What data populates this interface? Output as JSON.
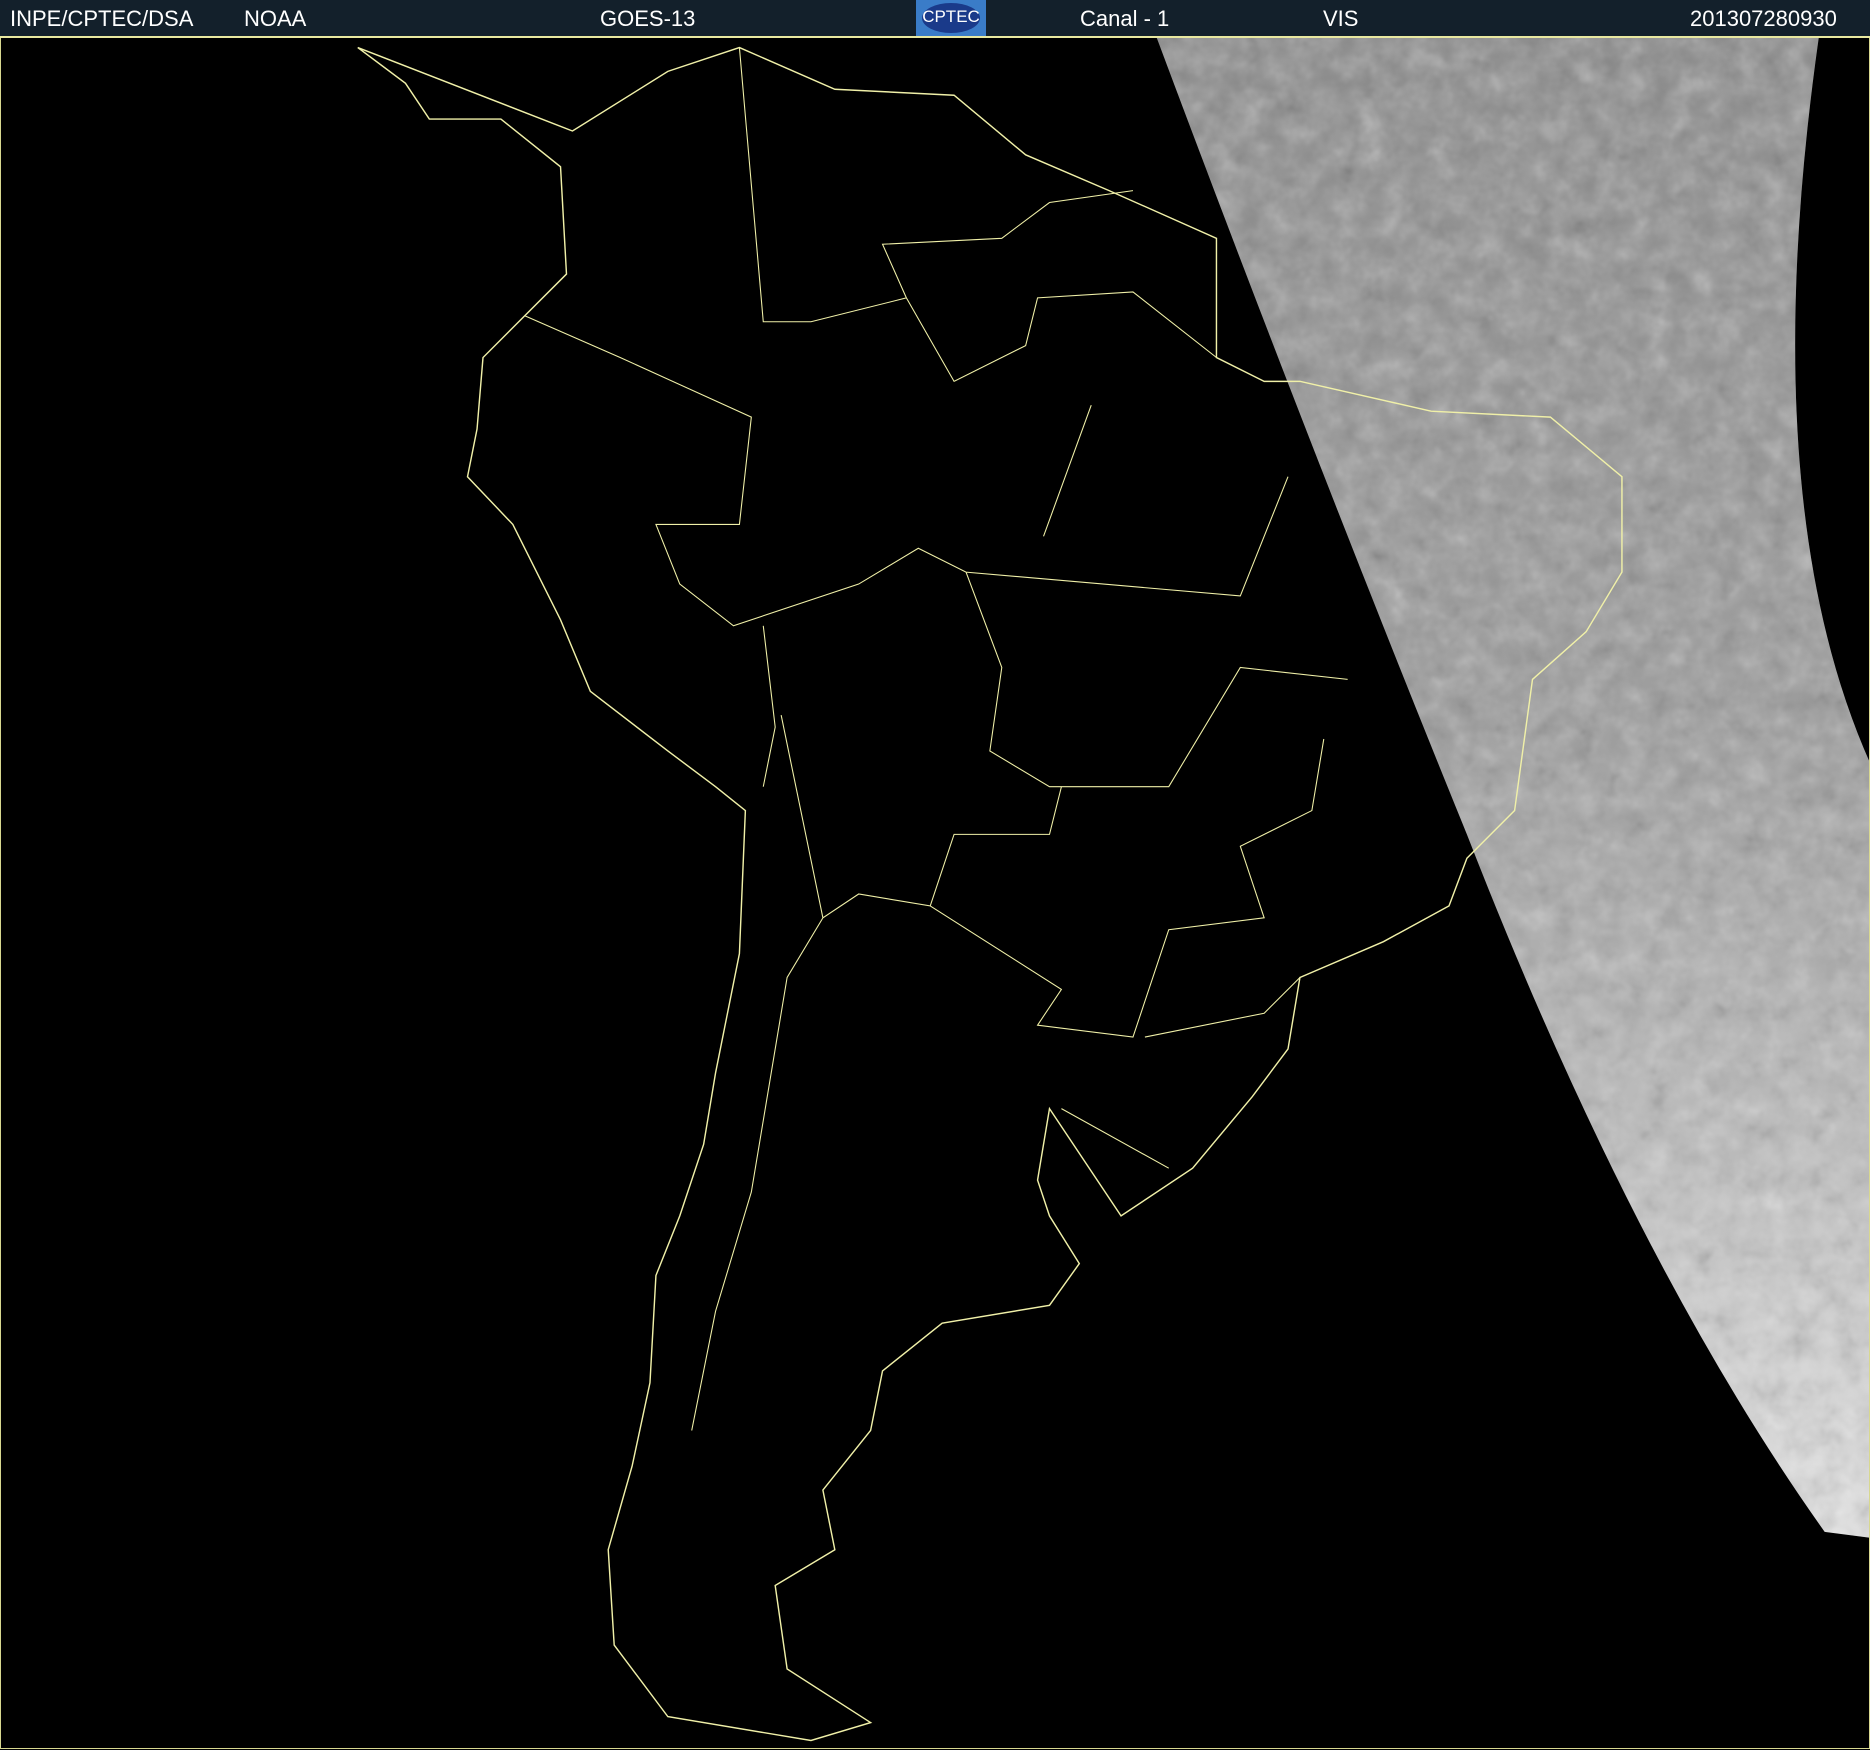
{
  "header": {
    "org": "INPE/CPTEC/DSA",
    "agency": "NOAA",
    "satellite": "GOES-13",
    "logo_text": "CPTEC",
    "channel": "Canal - 1",
    "band": "VIS",
    "timestamp": "201307280930"
  },
  "colors": {
    "header_bg": "#13202b",
    "borders": "#e8e8a0",
    "background": "#000000"
  }
}
